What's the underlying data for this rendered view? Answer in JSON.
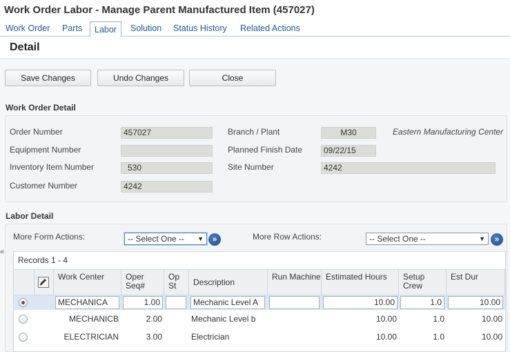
{
  "window": {
    "title": "Work Order Labor - Manage Parent Manufactured Item (457027)"
  },
  "tabs": [
    {
      "label": "Work Order"
    },
    {
      "label": "Parts"
    },
    {
      "label": "Labor"
    },
    {
      "label": "Solution"
    },
    {
      "label": "Status History"
    },
    {
      "label": "Related Actions"
    }
  ],
  "active_tab": "Labor",
  "detail": {
    "heading": "Detail"
  },
  "toolbar": {
    "save_label": "Save Changes",
    "undo_label": "Undo Changes",
    "close_label": "Close"
  },
  "work_order_detail": {
    "section_label": "Work Order Detail",
    "order_number": {
      "label": "Order Number",
      "value": "457027"
    },
    "equipment_number": {
      "label": "Equipment Number",
      "value": ""
    },
    "inventory_item_number": {
      "label": "Inventory Item Number",
      "value": "530"
    },
    "customer_number": {
      "label": "Customer Number",
      "value": "4242"
    },
    "branch_plant": {
      "label": "Branch / Plant",
      "value": "M30",
      "description": "Eastern Manufacturing Center"
    },
    "planned_finish_date": {
      "label": "Planned Finish Date",
      "value": "09/22/15"
    },
    "site_number": {
      "label": "Site Number",
      "value": "4242"
    }
  },
  "labor_detail": {
    "section_label": "Labor Detail",
    "more_form_actions": {
      "label": "More Form Actions:",
      "selected": "-- Select One --"
    },
    "more_row_actions": {
      "label": "More Row Actions:",
      "selected": "-- Select One --"
    },
    "records": "Records 1 - 4",
    "columns": {
      "work_center": "Work Center",
      "oper_seq": "Oper Seq#",
      "op_st": "Op St",
      "description": "Description",
      "run_machine": "Run Machine",
      "estimated_hours": "Estimated Hours",
      "setup_crew": "Setup Crew",
      "est_dur": "Est Dur"
    },
    "rows": [
      {
        "work_center": "MECHANICA",
        "oper_seq": "1.00",
        "op_st": "",
        "description": "Mechanic Level A",
        "run_machine": "",
        "estimated_hours": "10.00",
        "setup_crew": "1.0",
        "est_dur": "10.00"
      },
      {
        "work_center": "MECHANICB",
        "oper_seq": "2.00",
        "op_st": "",
        "description": "Mechanic Level b",
        "run_machine": "",
        "estimated_hours": "10.00",
        "setup_crew": "1.0",
        "est_dur": "10.00"
      },
      {
        "work_center": "ELECTRICIAN",
        "oper_seq": "3.00",
        "op_st": "",
        "description": "Electrician",
        "run_machine": "",
        "estimated_hours": "10.00",
        "setup_crew": "1.0",
        "est_dur": "10.00"
      }
    ]
  },
  "icons": {
    "go": "double-chevron-right-icon",
    "grid_header": "edit-grid-icon",
    "collapse": "chevron-left-icon"
  }
}
